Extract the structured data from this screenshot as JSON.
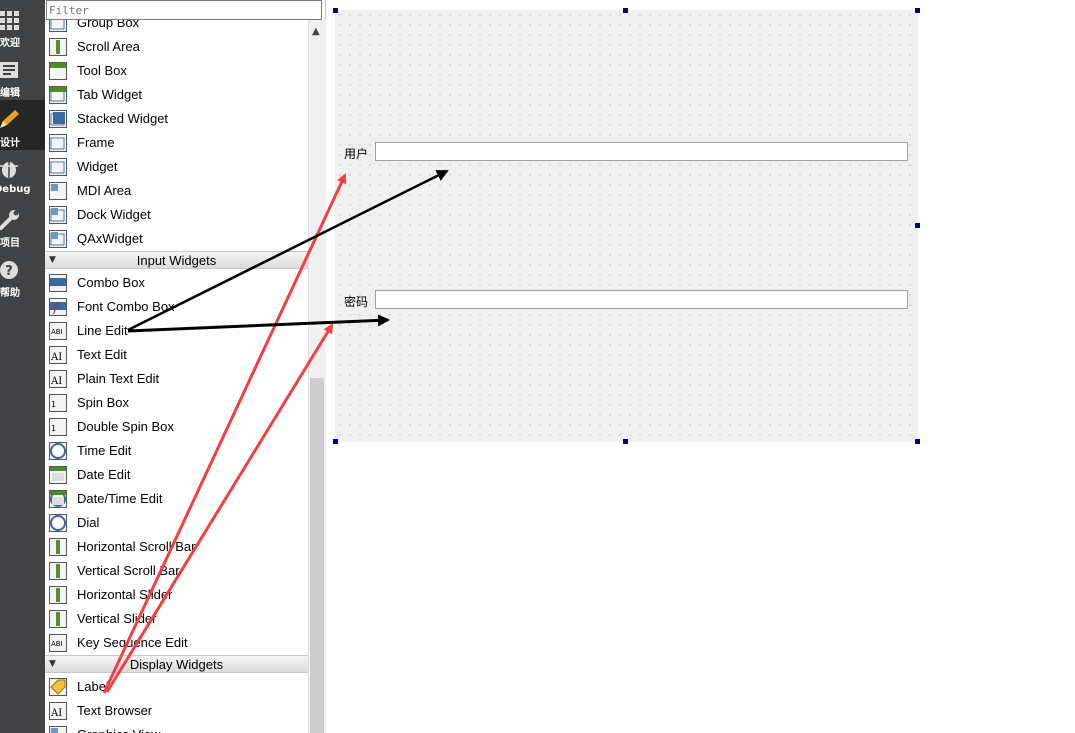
{
  "modebar": {
    "modes": [
      {
        "label": "欢迎",
        "icon": "grid-icon"
      },
      {
        "label": "编辑",
        "icon": "document-icon"
      },
      {
        "label": "设计",
        "icon": "pencil-icon",
        "active": true
      },
      {
        "label": "Debug",
        "icon": "bug-icon"
      },
      {
        "label": "项目",
        "icon": "wrench-icon"
      },
      {
        "label": "帮助",
        "icon": "help-icon"
      }
    ]
  },
  "widgetbox": {
    "filter_placeholder": "Filter",
    "items": [
      {
        "label": "Group Box",
        "icon": "group-box-icon"
      },
      {
        "label": "Scroll Area",
        "icon": "scroll-area-icon"
      },
      {
        "label": "Tool Box",
        "icon": "tool-box-icon"
      },
      {
        "label": "Tab Widget",
        "icon": "tab-widget-icon"
      },
      {
        "label": "Stacked Widget",
        "icon": "stacked-widget-icon"
      },
      {
        "label": "Frame",
        "icon": "frame-icon"
      },
      {
        "label": "Widget",
        "icon": "widget-icon"
      },
      {
        "label": "MDI Area",
        "icon": "mdi-area-icon"
      },
      {
        "label": "Dock Widget",
        "icon": "dock-widget-icon"
      },
      {
        "label": "QAxWidget",
        "icon": "qaxwidget-icon"
      },
      {
        "category": "Input Widgets"
      },
      {
        "label": "Combo Box",
        "icon": "combo-box-icon"
      },
      {
        "label": "Font Combo Box",
        "icon": "font-combo-box-icon"
      },
      {
        "label": "Line Edit",
        "icon": "line-edit-icon"
      },
      {
        "label": "Text Edit",
        "icon": "text-edit-icon"
      },
      {
        "label": "Plain Text Edit",
        "icon": "plain-text-edit-icon"
      },
      {
        "label": "Spin Box",
        "icon": "spin-box-icon"
      },
      {
        "label": "Double Spin Box",
        "icon": "double-spin-box-icon"
      },
      {
        "label": "Time Edit",
        "icon": "time-edit-icon"
      },
      {
        "label": "Date Edit",
        "icon": "date-edit-icon"
      },
      {
        "label": "Date/Time Edit",
        "icon": "datetime-edit-icon"
      },
      {
        "label": "Dial",
        "icon": "dial-icon"
      },
      {
        "label": "Horizontal Scroll Bar",
        "icon": "horizontal-scroll-bar-icon"
      },
      {
        "label": "Vertical Scroll Bar",
        "icon": "vertical-scroll-bar-icon"
      },
      {
        "label": "Horizontal Slider",
        "icon": "horizontal-slider-icon"
      },
      {
        "label": "Vertical Slider",
        "icon": "vertical-slider-icon"
      },
      {
        "label": "Key Sequence Edit",
        "icon": "key-sequence-edit-icon"
      },
      {
        "category": "Display Widgets"
      },
      {
        "label": "Label",
        "icon": "label-icon"
      },
      {
        "label": "Text Browser",
        "icon": "text-browser-icon"
      },
      {
        "label": "Graphics View",
        "icon": "graphics-view-icon"
      }
    ]
  },
  "form": {
    "user_label": "用户",
    "password_label": "密码"
  },
  "colors": {
    "modebar_bg": "#404244",
    "handle": "#000080",
    "arrow_red": "#f04040",
    "arrow_black": "#000000"
  }
}
